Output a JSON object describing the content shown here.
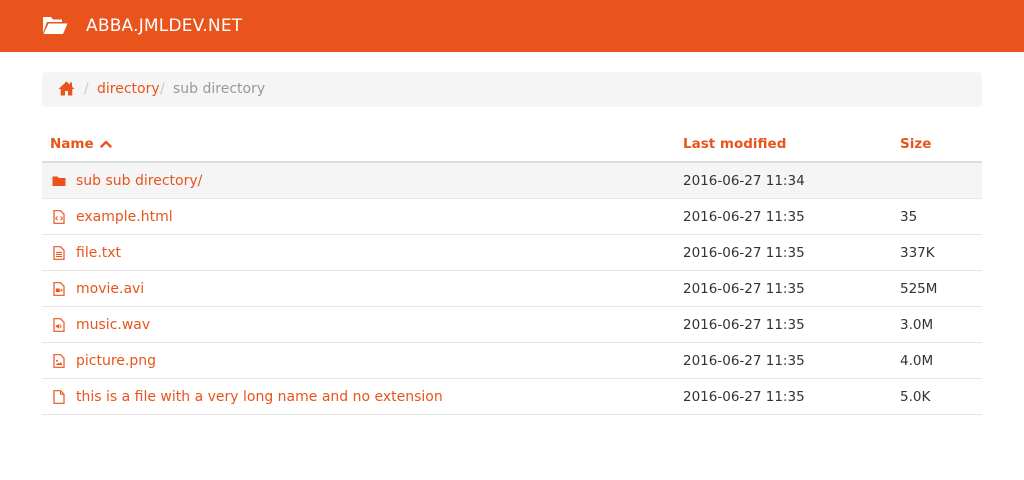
{
  "header": {
    "title": "ABBA.JMLDEV.NET",
    "brand_color": "#e9541c",
    "logo_icon": "folder-open-icon"
  },
  "breadcrumb": {
    "home_icon": "home-icon",
    "separator": "/",
    "items": [
      {
        "label": "directory",
        "active": false
      },
      {
        "label": "sub directory",
        "active": true
      }
    ]
  },
  "table": {
    "columns": {
      "name": "Name",
      "last_modified": "Last modified",
      "size": "Size"
    },
    "sort_icon": "chevron-up-icon",
    "rows": [
      {
        "name": "sub sub directory/",
        "modified": "2016-06-27 11:34",
        "size": "",
        "icon": "folder-icon"
      },
      {
        "name": "example.html",
        "modified": "2016-06-27 11:35",
        "size": "35",
        "icon": "file-code-icon"
      },
      {
        "name": "file.txt",
        "modified": "2016-06-27 11:35",
        "size": "337K",
        "icon": "file-text-icon"
      },
      {
        "name": "movie.avi",
        "modified": "2016-06-27 11:35",
        "size": "525M",
        "icon": "file-video-icon"
      },
      {
        "name": "music.wav",
        "modified": "2016-06-27 11:35",
        "size": "3.0M",
        "icon": "file-audio-icon"
      },
      {
        "name": "picture.png",
        "modified": "2016-06-27 11:35",
        "size": "4.0M",
        "icon": "file-image-icon"
      },
      {
        "name": "this is a file with a very long name and no extension",
        "modified": "2016-06-27 11:35",
        "size": "5.0K",
        "icon": "file-icon"
      }
    ]
  }
}
